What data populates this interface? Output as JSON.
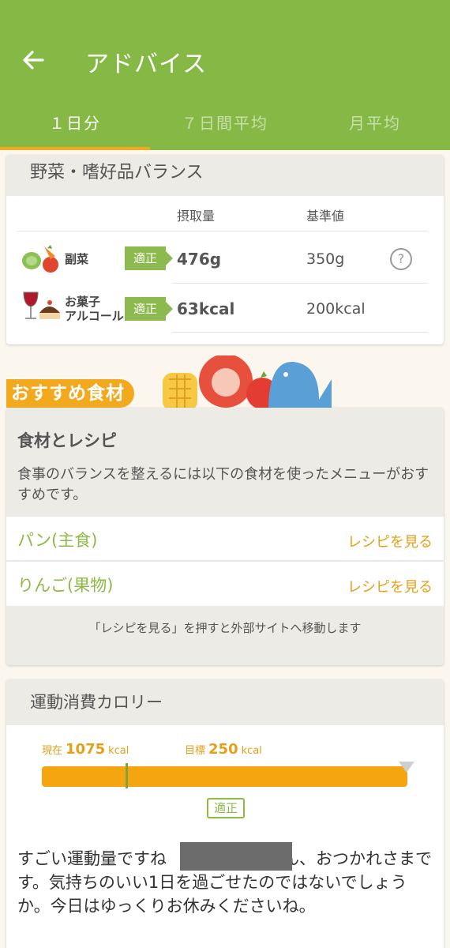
{
  "header": {
    "title": "アドバイス",
    "tabs": [
      {
        "label": "１日分",
        "active": true
      },
      {
        "label": "７日間平均",
        "active": false
      },
      {
        "label": "月平均",
        "active": false
      }
    ]
  },
  "balance": {
    "title": "野菜・嗜好品バランス",
    "col_intake": "摂取量",
    "col_standard": "基準値",
    "rows": [
      {
        "label": "副菜",
        "status": "適正",
        "intake": "476g",
        "standard": "350g"
      },
      {
        "label_line1": "お菓子",
        "label_line2": "アルコール",
        "status": "適正",
        "intake": "63kcal",
        "standard": "200kcal"
      }
    ],
    "help_symbol": "?"
  },
  "recommend": {
    "banner": "おすすめ食材",
    "card_title": "食材とレシピ",
    "description": "食事のバランスを整えるには以下の食材を使ったメニューがおすすめです。",
    "items": [
      {
        "name": "パン(主食)",
        "link": "レシピを見る"
      },
      {
        "name": "りんご(果物)",
        "link": "レシピを見る"
      }
    ],
    "note": "「レシピを見る」を押すと外部サイトへ移動します"
  },
  "exercise": {
    "title": "運動消費カロリー",
    "current_label": "現在",
    "current_value": "1075",
    "goal_label": "目標",
    "goal_value": "250",
    "unit": "kcal",
    "status": "適正",
    "message": "すごい運動量ですね　　　　　　さん、おつかれさまです。気持ちのいい1日を過ごせたのではないでしょうか。今日はゆっくりお休みくださいね。"
  },
  "colors": {
    "header": "#86b845",
    "accent": "#f2a91e",
    "green": "#8cba45"
  }
}
